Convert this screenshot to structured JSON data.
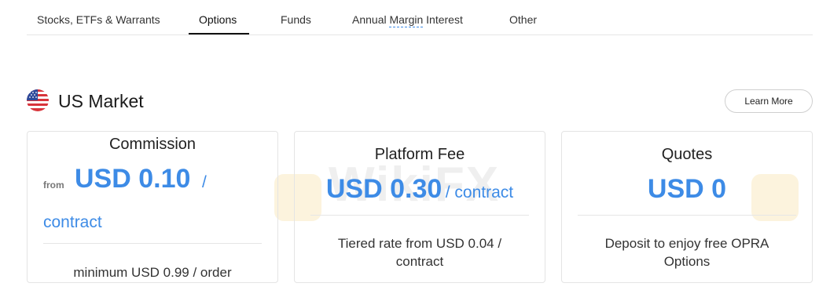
{
  "tabs": [
    {
      "label": "Stocks, ETFs & Warrants"
    },
    {
      "label": "Options",
      "active": true
    },
    {
      "label": "Funds"
    },
    {
      "label_prefix": "Annual ",
      "label_dotted": "Margin",
      "label_suffix": " Interest"
    },
    {
      "label": "Other"
    }
  ],
  "watermark": "WikiFX",
  "section": {
    "flag_icon": "us-flag-icon",
    "title": "US Market",
    "learn_more": "Learn More"
  },
  "cards": [
    {
      "title": "Commission",
      "prefix": "from",
      "price": "USD 0.10",
      "slash": "/",
      "unit": "contract",
      "note": "minimum USD 0.99 / order"
    },
    {
      "title": "Platform Fee",
      "price": "USD 0.30",
      "unit": "/ contract",
      "note_line1": "Tiered rate from USD 0.04 /",
      "note_line2": "contract"
    },
    {
      "title": "Quotes",
      "price": "USD 0",
      "note_line1": "Deposit to enjoy free OPRA",
      "note_line2": "Options"
    }
  ],
  "colors": {
    "accent": "#3d8be6",
    "text": "#222222",
    "border": "#e4e4e4"
  }
}
